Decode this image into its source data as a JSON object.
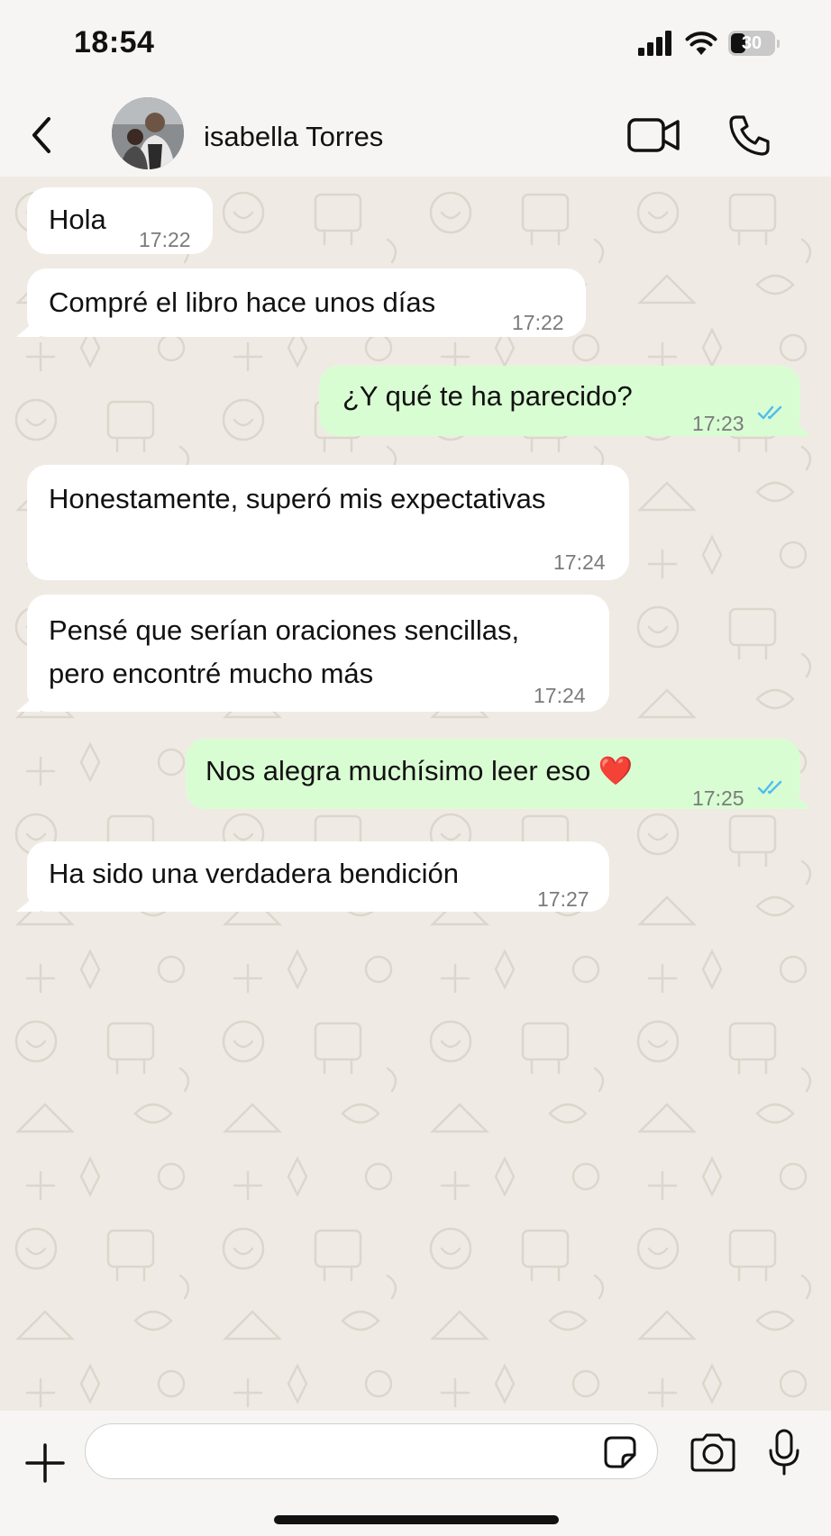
{
  "status_bar": {
    "time": "18:54",
    "battery": "30"
  },
  "header": {
    "contact_name": "isabella Torres"
  },
  "messages": [
    {
      "direction": "incoming",
      "text": "Hola",
      "time": "17:22"
    },
    {
      "direction": "incoming",
      "text": "Compré el libro hace unos días",
      "time": "17:22"
    },
    {
      "direction": "outgoing",
      "text": "¿Y qué te ha parecido?",
      "time": "17:23",
      "read": true
    },
    {
      "direction": "incoming",
      "text": "Honestamente, superó mis expectativas",
      "time": "17:24"
    },
    {
      "direction": "incoming",
      "lines": [
        "Pensé que serían oraciones sencillas,",
        "pero encontré mucho más"
      ],
      "time": "17:24"
    },
    {
      "direction": "outgoing",
      "text": "Nos alegra muchísimo leer eso ❤️",
      "time": "17:25",
      "read": true
    },
    {
      "direction": "incoming",
      "text": "Ha sido una verdadera bendición",
      "time": "17:27"
    }
  ],
  "composer": {
    "value": "",
    "placeholder": ""
  },
  "colors": {
    "outgoing_bubble": "#d9fdd3",
    "incoming_bubble": "#ffffff",
    "read_ticks": "#53bdeb",
    "chat_background": "#efebe4"
  },
  "icons": {
    "back": "chevron-left-icon",
    "video": "video-camera-icon",
    "call": "phone-icon",
    "attach": "plus-icon",
    "sticker": "sticker-icon",
    "camera": "camera-icon",
    "mic": "microphone-icon"
  }
}
